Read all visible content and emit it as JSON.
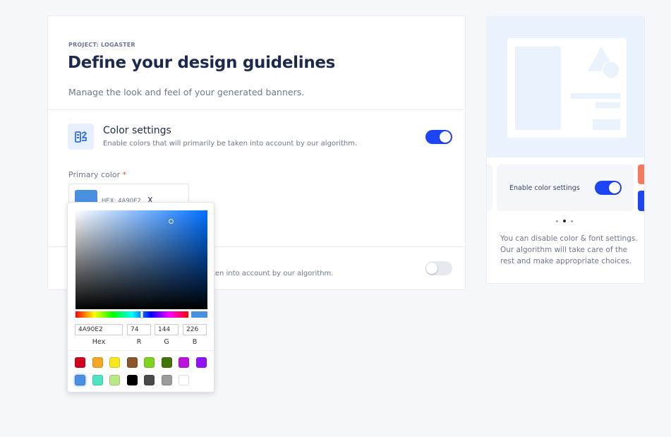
{
  "header": {
    "eyebrow": "PROJECT: LOGASTER",
    "title": "Define your design guidelines",
    "subtitle": "Manage the look and feel of your generated banners."
  },
  "color_section": {
    "icon": "palette-swatch-icon",
    "title": "Color settings",
    "description": "Enable colors that will primarily be taken into account by our algorithm.",
    "enabled": true,
    "primary_color_label": "Primary color",
    "required_mark": "*",
    "primary_color_hex_text": "HEX: 4A90E2",
    "primary_color": "#4A90E2",
    "clear_label": "X"
  },
  "font_section": {
    "description_visible": "e taken into account by our algorithm.",
    "enabled": false
  },
  "color_picker": {
    "hex_value": "4A90E2",
    "r_value": "74",
    "g_value": "144",
    "b_value": "226",
    "hex_label": "Hex",
    "r_label": "R",
    "g_label": "G",
    "b_label": "B",
    "presets_row1": [
      "#D0021B",
      "#F5A623",
      "#F8E71C",
      "#8B572A",
      "#7ED321",
      "#417505",
      "#BD10E0",
      "#9013FE"
    ],
    "presets_row2": [
      "#4A90E2",
      "#50E3C2",
      "#B8E986",
      "#000000",
      "#4A4A4A",
      "#9B9B9B",
      "#FFFFFF"
    ],
    "selected_preset": "#4A90E2"
  },
  "side_panel": {
    "slide_label": "Enable color settings",
    "slide_toggle_on": true,
    "carousel_dots": 3,
    "active_dot": 2,
    "help_text": "You can disable color & font settings. Our algorithm will take care of the rest and make appropriate choices."
  },
  "colors": {
    "accent": "#1C46F5",
    "title": "#1C2B4D",
    "muted": "#6F7791",
    "illustration_bg": "#EAF2FE"
  }
}
